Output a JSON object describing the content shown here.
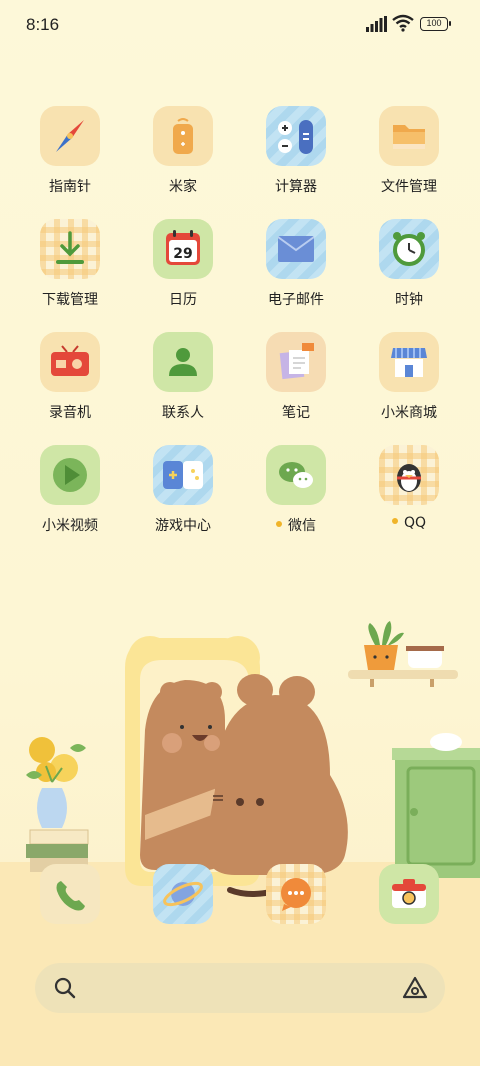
{
  "status_bar": {
    "time": "8:16",
    "battery": "100"
  },
  "apps": [
    {
      "label": "指南针",
      "icon": "compass-icon"
    },
    {
      "label": "米家",
      "icon": "mijia-remote-icon"
    },
    {
      "label": "计算器",
      "icon": "calculator-icon"
    },
    {
      "label": "文件管理",
      "icon": "folder-icon"
    },
    {
      "label": "下载管理",
      "icon": "download-icon"
    },
    {
      "label": "日历",
      "icon": "calendar-icon",
      "day": "29"
    },
    {
      "label": "电子邮件",
      "icon": "mail-icon"
    },
    {
      "label": "时钟",
      "icon": "clock-icon"
    },
    {
      "label": "录音机",
      "icon": "radio-recorder-icon"
    },
    {
      "label": "联系人",
      "icon": "contact-person-icon"
    },
    {
      "label": "笔记",
      "icon": "notes-icon"
    },
    {
      "label": "小米商城",
      "icon": "store-icon"
    },
    {
      "label": "小米视频",
      "icon": "play-icon"
    },
    {
      "label": "游戏中心",
      "icon": "gamepad-icon"
    },
    {
      "label": "微信",
      "icon": "wechat-icon",
      "new_dot": true
    },
    {
      "label": "QQ",
      "icon": "qq-penguin-icon",
      "new_dot": true
    }
  ],
  "dock": [
    {
      "icon": "phone-icon"
    },
    {
      "icon": "browser-planet-icon"
    },
    {
      "icon": "messages-icon"
    },
    {
      "icon": "camera-icon"
    }
  ],
  "colors": {
    "new_dot": "#f0b429",
    "background": "#fdf8da",
    "search_bar": "#eee2b8"
  }
}
